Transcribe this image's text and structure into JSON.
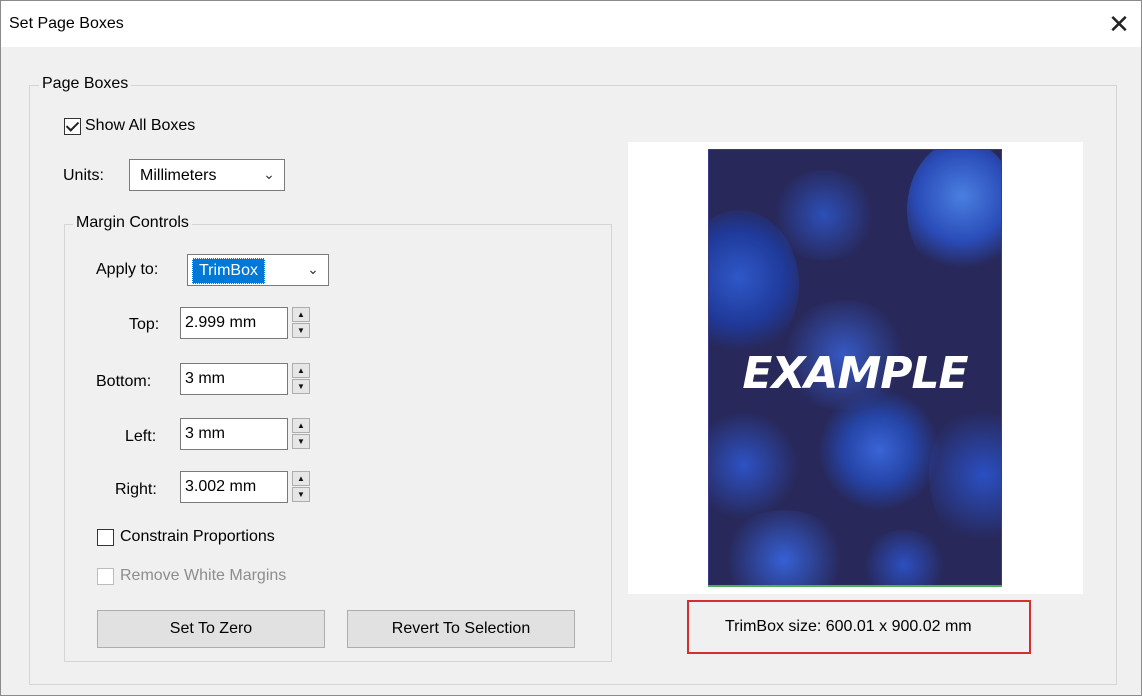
{
  "window": {
    "title": "Set Page Boxes",
    "close_glyph": "✕"
  },
  "page_boxes": {
    "legend": "Page Boxes",
    "show_all_boxes": {
      "label": "Show All Boxes",
      "checked": true
    },
    "units": {
      "label": "Units:",
      "value": "Millimeters"
    }
  },
  "margin_controls": {
    "legend": "Margin Controls",
    "apply_to": {
      "label": "Apply to:",
      "value": "TrimBox"
    },
    "top": {
      "label": "Top:",
      "value": "2.999 mm"
    },
    "bottom": {
      "label": "Bottom:",
      "value": "3 mm"
    },
    "left": {
      "label": "Left:",
      "value": "3 mm"
    },
    "right": {
      "label": "Right:",
      "value": "3.002 mm"
    },
    "constrain": {
      "label": "Constrain Proportions",
      "checked": false
    },
    "remove_white": {
      "label": "Remove White Margins",
      "checked": false,
      "disabled": true
    },
    "set_to_zero_label": "Set To Zero",
    "revert_label": "Revert To Selection"
  },
  "preview": {
    "poster_text": "EXAMPLE",
    "size_text": "TrimBox size: 600.01 x 900.02 mm",
    "highlight_color": "#d32f2f"
  }
}
